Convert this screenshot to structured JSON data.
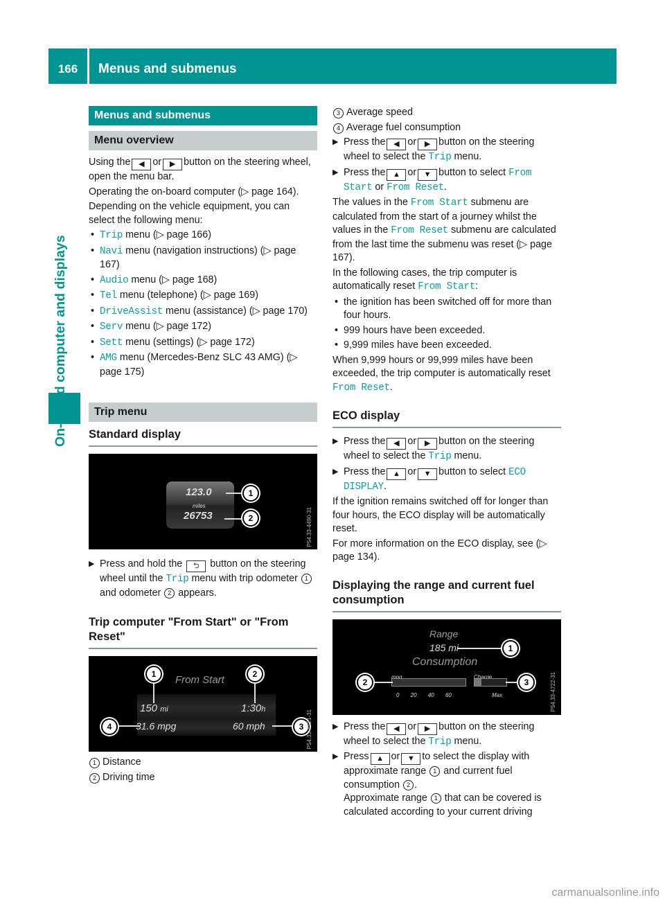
{
  "header": {
    "page_number": "166",
    "title": "Menus and submenus"
  },
  "sidebar": {
    "section_title": "On-board computer and displays"
  },
  "left": {
    "section_heading": "Menus and submenus",
    "menu_overview": {
      "heading": "Menu overview",
      "p1_a": "Using the",
      "p1_or": "or",
      "p1_b": "button on the steering wheel, open the menu bar.",
      "p2": "Operating the on-board computer (▷ page 164).",
      "p3": "Depending on the vehicle equipment, you can select the following menu:",
      "items": [
        {
          "code": "Trip",
          "text": " menu (▷ page 166)"
        },
        {
          "code": "Navi",
          "text": " menu (navigation instructions) (▷ page 167)"
        },
        {
          "code": "Audio",
          "text": " menu (▷ page 168)"
        },
        {
          "code": "Tel",
          "text": " menu (telephone) (▷ page 169)"
        },
        {
          "code": "DriveAssist",
          "text": " menu (assistance) (▷ page 170)"
        },
        {
          "code": "Serv",
          "text": " menu (▷ page 172)"
        },
        {
          "code": "Sett",
          "text": " menu (settings) (▷ page 172)"
        },
        {
          "code": "AMG",
          "text": " menu (Mercedes-Benz SLC 43 AMG) (▷ page 175)"
        }
      ]
    },
    "trip_menu": {
      "heading": "Trip menu",
      "standard_display": {
        "heading": "Standard display",
        "figure": {
          "trip_value": "123.0",
          "unit": "miles",
          "odometer": "26753",
          "code": "P54.33-4490-31",
          "callouts": [
            "1",
            "2"
          ]
        },
        "step_a": "Press and hold the",
        "step_code": "Trip",
        "step_b": "button on the steering wheel until the",
        "step_c": "menu with trip odometer",
        "step_d": "and odometer",
        "step_e": "appears."
      },
      "trip_computer": {
        "heading": "Trip computer \"From Start\" or \"From Reset\"",
        "figure": {
          "title": "From Start",
          "distance": "150",
          "distance_unit": "mi",
          "time": "1:30",
          "time_unit": "h",
          "consumption": "31.6 mpg",
          "speed": "60 mph",
          "code": "P54.33-4721-31",
          "callouts": [
            "1",
            "2",
            "3",
            "4"
          ]
        },
        "legend": [
          {
            "num": "1",
            "label": "Distance"
          },
          {
            "num": "2",
            "label": "Driving time"
          }
        ]
      }
    }
  },
  "right": {
    "legend_cont": [
      {
        "num": "3",
        "label": "Average speed"
      },
      {
        "num": "4",
        "label": "Average fuel consumption"
      }
    ],
    "step1_a": "Press the",
    "step1_or": "or",
    "step1_b": "button on the steering wheel to select the",
    "step1_code": "Trip",
    "step1_c": "menu.",
    "step2_a": "Press the",
    "step2_or": "or",
    "step2_b": "button to select",
    "step2_code1": "From Start",
    "step2_or2": "or",
    "step2_code2": "From Reset",
    "step2_end": ".",
    "para1_a": "The values in the",
    "para1_code1": "From Start",
    "para1_b": "submenu are calculated from the start of a journey whilst the values in the",
    "para1_code2": "From Reset",
    "para1_c": "submenu are calculated from the last time the submenu was reset (▷ page 167).",
    "para2_a": "In the following cases, the trip computer is automatically reset",
    "para2_code": "From Start",
    "para2_end": ":",
    "reset_cases": [
      "the ignition has been switched off for more than four hours.",
      "999 hours have been exceeded.",
      "9,999 miles have been exceeded."
    ],
    "para3_a": "When 9,999 hours or 99,999 miles have been exceeded, the trip computer is automatically reset",
    "para3_code": "From Reset",
    "para3_end": ".",
    "eco": {
      "heading": "ECO display",
      "step1_a": "Press the",
      "step1_or": "or",
      "step1_b": "button on the steering wheel to select the",
      "step1_code": "Trip",
      "step1_c": "menu.",
      "step2_a": "Press the",
      "step2_or": "or",
      "step2_b": "button to select",
      "step2_code": "ECO DISPLAY",
      "step2_end": ".",
      "para1": "If the ignition remains switched off for longer than four hours, the ECO display will be automatically reset.",
      "para2": "For more information on the ECO display, see (▷ page 134)."
    },
    "range": {
      "heading": "Displaying the range and current fuel consumption",
      "figure": {
        "range_label": "Range",
        "range_value": "185 mi",
        "consumption_label": "Consumption",
        "mpg_label": "mpg",
        "charge_label": "Charge",
        "scale": [
          "0",
          "20",
          "40",
          "60"
        ],
        "max_label": "Max",
        "code": "P54.33-4722-31",
        "callouts": [
          "1",
          "2",
          "3"
        ]
      },
      "step1_a": "Press the",
      "step1_or": "or",
      "step1_b": "button on the steering wheel to select the",
      "step1_code": "Trip",
      "step1_c": "menu.",
      "step2_a": "Press",
      "step2_or": "or",
      "step2_b": "to select the display with approximate range",
      "step2_c": "and current fuel consumption",
      "step2_end": ".",
      "step2_d": "Approximate range",
      "step2_e": "that can be covered is calculated according to your current driving"
    }
  },
  "icons": {
    "left": "◀",
    "right": "▶",
    "up": "▲",
    "down": "▼",
    "back": "⮌",
    "step_arrow": "▶",
    "page_ref": "▷"
  },
  "watermark": "carmanualsonline.info"
}
